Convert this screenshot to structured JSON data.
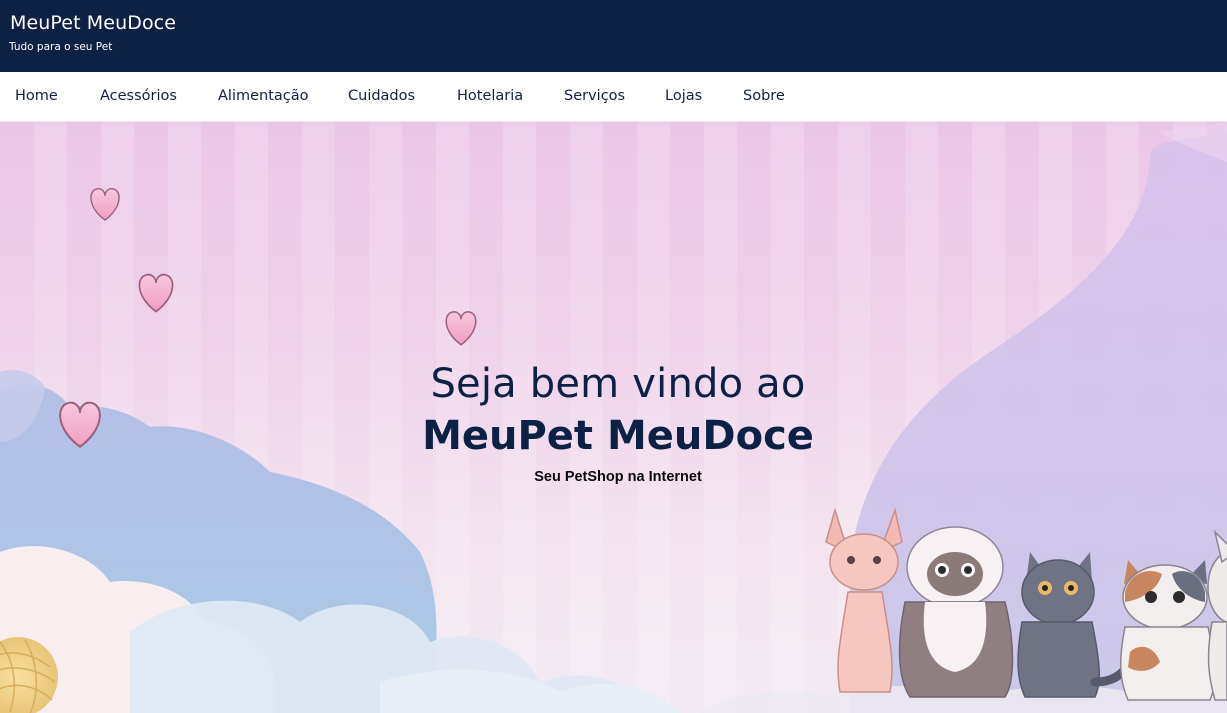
{
  "header": {
    "title": "MeuPet MeuDoce",
    "tagline": "Tudo para o seu Pet"
  },
  "nav": {
    "items": [
      {
        "label": "Home"
      },
      {
        "label": "Acessórios"
      },
      {
        "label": "Alimentação"
      },
      {
        "label": "Cuidados"
      },
      {
        "label": "Hotelaria"
      },
      {
        "label": "Serviços"
      },
      {
        "label": "Lojas"
      },
      {
        "label": "Sobre"
      }
    ]
  },
  "hero": {
    "heading_line1": "Seja bem vindo ao",
    "heading_line2": "MeuPet MeuDoce",
    "subtitle": "Seu PetShop na Internet"
  },
  "colors": {
    "header_bg": "#0d2145",
    "header_text": "#ffffff",
    "nav_text": "#14213d",
    "hero_bg": "#efd3ea",
    "hero_text": "#0d2145",
    "heart": "#f2a7c9"
  },
  "icons": [
    "heart-icon",
    "yarn-ball-icon"
  ]
}
